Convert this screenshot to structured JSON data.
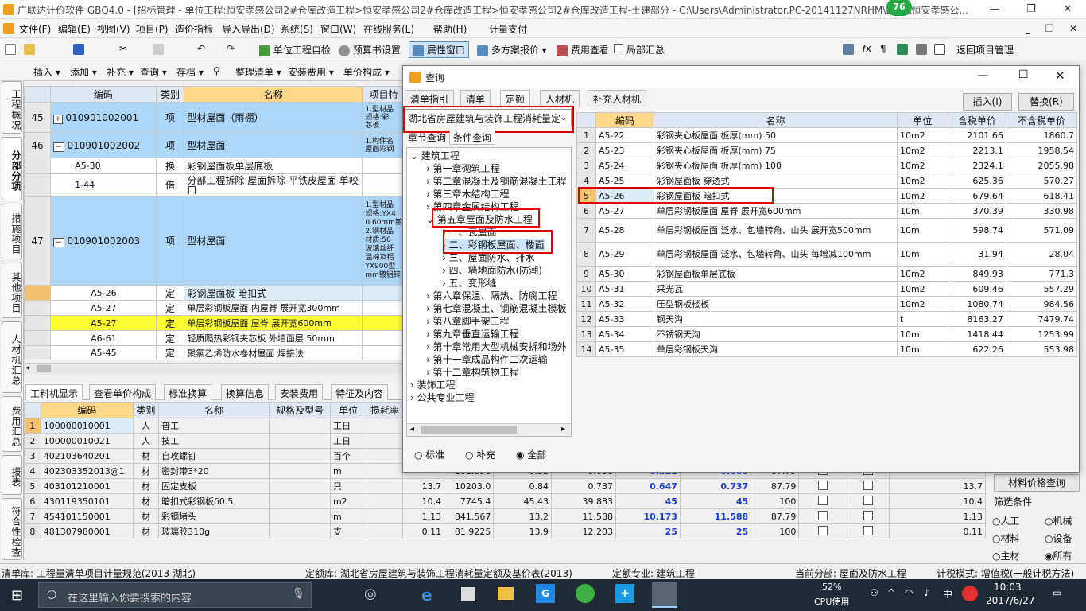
{
  "window": {
    "title": "广联达计价软件 GBQ4.0 - [招标管理 - 单位工程:恒安孝感公司2#仓库改造工程>恒安孝感公司2#仓库改造工程>恒安孝感公司2#仓库改造工程-土建部分 - C:\\Users\\Administrator.PC-20141127NRHM\\De...\\恒安孝感公...",
    "badge": "76",
    "minimize": "—",
    "restore": "❐",
    "close": "✕"
  },
  "menu": [
    "文件(F)",
    "编辑(E)",
    "视图(V)",
    "项目(P)",
    "造价指标",
    "导入导出(D)",
    "系统(S)",
    "窗口(W)",
    "在线服务(L)",
    "帮助(H)",
    "计量支付"
  ],
  "toolbar1": {
    "self_check": "单位工程自检",
    "budget_setting": "预算书设置",
    "property_window": "属性窗口",
    "multi_quote": "多方案报价",
    "fee_view": "费用查看",
    "partial_summary": "局部汇总",
    "return_project": "返回项目管理"
  },
  "toolbar2": {
    "insert": "插入",
    "add": "添加",
    "supplement": "补充",
    "query": "查询",
    "save": "存档",
    "organize": "整理清单",
    "install_fee": "安装费用",
    "price_compose": "单价构成"
  },
  "side_tabs": [
    "工程概况",
    "分部分项",
    "措施项目",
    "其他项目",
    "人材机汇总",
    "费用汇总",
    "报表",
    "符合性检查"
  ],
  "main_grid": {
    "headers": [
      "编码",
      "类别",
      "名称",
      "项目特"
    ],
    "rows": [
      {
        "no": "45",
        "code": "010901002001",
        "type": "项",
        "name": "型材屋面（雨棚）",
        "feature": "1.型材品\n规格:彩\n芯板"
      },
      {
        "no": "46",
        "code": "010901002002",
        "type": "项",
        "name": "型材屋面",
        "feature": "1.构件名\n屋面彩钢"
      },
      {
        "no": "",
        "code": "A5-30",
        "type": "换",
        "name": "彩钢屋面板单层底板",
        "feature": ""
      },
      {
        "no": "",
        "code": "1-44",
        "type": "借",
        "name": "分部工程拆除 屋面拆除 平铁皮屋面 单咬口",
        "feature": ""
      },
      {
        "no": "47",
        "code": "010901002003",
        "type": "项",
        "name": "型材屋面",
        "feature": "1.型材品\n规格:YX4\n0.60mm镀\n2.钢材品\n材质:50\n玻璃丝纤\n温棉及铝\nYX900型\nmm镀铝锌"
      },
      {
        "no": "",
        "code": "A5-26",
        "type": "定",
        "name": "彩钢屋面板 暗扣式",
        "feature": ""
      },
      {
        "no": "",
        "code": "A5-27",
        "type": "定",
        "name": "单层彩钢板屋面 内屋脊 展开宽300mm",
        "feature": ""
      },
      {
        "no": "",
        "code": "A5-27",
        "type": "定",
        "name": "单层彩钢板屋面 屋脊 展开宽600mm",
        "feature": ""
      },
      {
        "no": "",
        "code": "A6-61",
        "type": "定",
        "name": "轻质隔热彩钢夹芯板 外墙面层 50mm",
        "feature": ""
      },
      {
        "no": "",
        "code": "A5-45",
        "type": "定",
        "name": "聚氯乙烯防水卷材屋面 焊接法",
        "feature": ""
      }
    ]
  },
  "bottom_tabs": [
    "工料机显示",
    "查看单价构成",
    "标准换算",
    "换算信息",
    "安装费用",
    "特征及内容"
  ],
  "bottom_grid": {
    "headers": [
      "编码",
      "类别",
      "名称",
      "规格及型号",
      "单位",
      "损耗率"
    ],
    "rows": [
      {
        "no": "1",
        "code": "100000010001",
        "type": "人",
        "name": "普工",
        "spec": "",
        "unit": "工日",
        "loss": "",
        "a": "",
        "b": "",
        "c": "",
        "d": "",
        "e": "",
        "f": "",
        "g": "",
        "h": ""
      },
      {
        "no": "2",
        "code": "100000010021",
        "type": "人",
        "name": "技工",
        "spec": "",
        "unit": "工日",
        "loss": "",
        "a": "",
        "b": "",
        "c": "",
        "d": "",
        "e": "",
        "f": "",
        "g": "",
        "h": ""
      },
      {
        "no": "3",
        "code": "402103640201",
        "type": "材",
        "name": "自攻螺钉",
        "spec": "",
        "unit": "百个",
        "loss": "",
        "a": "",
        "b": "",
        "c": "",
        "d": "",
        "e": "",
        "f": "",
        "g": "",
        "h": ""
      },
      {
        "no": "4",
        "code": "402303352013@1",
        "type": "材",
        "name": "密封带3*20",
        "spec": "",
        "unit": "m",
        "loss": "",
        "a": "101.090",
        "b": "0.32",
        "c": "0.030",
        "d": "0.321",
        "e": "0.000",
        "f": "87.79",
        "g": "",
        "h": ""
      },
      {
        "no": "5",
        "code": "403101210001",
        "type": "材",
        "name": "固定支板",
        "spec": "",
        "unit": "只",
        "loss": "13.7",
        "a": "10203.0",
        "b": "0.84",
        "c": "0.737",
        "d": "0.647",
        "e": "0.737",
        "f": "87.79",
        "g": "13.7",
        "h": ""
      },
      {
        "no": "6",
        "code": "430119350101",
        "type": "材",
        "name": "暗扣式彩钢板δ0.5",
        "spec": "",
        "unit": "m2",
        "loss": "10.4",
        "a": "7745.4",
        "b": "45.43",
        "c": "39.883",
        "d": "45",
        "e": "45",
        "f": "100",
        "g": "10.4",
        "h": ""
      },
      {
        "no": "7",
        "code": "454101150001",
        "type": "材",
        "name": "彩钢堵头",
        "spec": "",
        "unit": "m",
        "loss": "1.13",
        "a": "841.567",
        "b": "13.2",
        "c": "11.588",
        "d": "10.173",
        "e": "11.588",
        "f": "87.79",
        "g": "1.13",
        "h": ""
      },
      {
        "no": "8",
        "code": "481307980001",
        "type": "材",
        "name": "玻璃胶310g",
        "spec": "",
        "unit": "支",
        "loss": "0.11",
        "a": "81.9225",
        "b": "13.9",
        "c": "12.203",
        "d": "25",
        "e": "25",
        "f": "100",
        "g": "0.11",
        "h": ""
      }
    ]
  },
  "right_panel": {
    "price_query": "材料价格查询",
    "filter_label": "筛选条件",
    "options": [
      "人工",
      "机械",
      "材料",
      "设备",
      "主材",
      "所有"
    ]
  },
  "dialog": {
    "title": "查询",
    "tabs": [
      "清单指引",
      "清单",
      "定额",
      "人材机",
      "补充人材机"
    ],
    "insert": "插入(I)",
    "replace": "替换(R)",
    "library": "湖北省房屋建筑与装饰工程消耗量定",
    "subtabs": [
      "章节查询",
      "条件查询"
    ],
    "tree": [
      "建筑工程",
      "第一章砌筑工程",
      "第二章混凝土及钢筋混凝土工程",
      "第三章木结构工程",
      "第四章金属结构工程",
      "第五章屋面及防水工程",
      "一、瓦屋面",
      "二、彩钢板屋面、楼面",
      "三、屋面防水、排水",
      "四、墙地面防水(防潮)",
      "五、变形缝",
      "第六章保温、隔热、防腐工程",
      "第七章混凝土、钢筋混凝土模板",
      "第八章脚手架工程",
      "第九章垂直运输工程",
      "第十章常用大型机械安拆和场外",
      "第十一章成品构件二次运输",
      "第十二章构筑物工程",
      "装饰工程",
      "公共专业工程"
    ],
    "radios": [
      "标准",
      "补充",
      "全部"
    ],
    "grid_headers": [
      "编码",
      "名称",
      "单位",
      "含税单价",
      "不含税单价"
    ],
    "grid_rows": [
      {
        "n": "1",
        "code": "A5-22",
        "name": "彩钢夹心板屋面 板厚(mm) 50",
        "unit": "10m2",
        "tax": "2101.66",
        "notax": "1860.7"
      },
      {
        "n": "2",
        "code": "A5-23",
        "name": "彩钢夹心板屋面 板厚(mm) 75",
        "unit": "10m2",
        "tax": "2213.1",
        "notax": "1958.54"
      },
      {
        "n": "3",
        "code": "A5-24",
        "name": "彩钢夹心板屋面 板厚(mm) 100",
        "unit": "10m2",
        "tax": "2324.1",
        "notax": "2055.98"
      },
      {
        "n": "4",
        "code": "A5-25",
        "name": "彩钢屋面板 穿透式",
        "unit": "10m2",
        "tax": "625.36",
        "notax": "570.27"
      },
      {
        "n": "5",
        "code": "A5-26",
        "name": "彩钢屋面板 暗扣式",
        "unit": "10m2",
        "tax": "679.64",
        "notax": "618.41"
      },
      {
        "n": "6",
        "code": "A5-27",
        "name": "单层彩钢板屋面 屋脊 展开宽600mm",
        "unit": "10m",
        "tax": "370.39",
        "notax": "330.98"
      },
      {
        "n": "7",
        "code": "A5-28",
        "name": "单层彩钢板屋面 泛水、包墙转角、山头 展开宽500mm",
        "unit": "10m",
        "tax": "598.74",
        "notax": "571.09"
      },
      {
        "n": "8",
        "code": "A5-29",
        "name": "单层彩钢板屋面 泛水、包墙转角、山头 每增减100mm",
        "unit": "10m",
        "tax": "31.94",
        "notax": "28.04"
      },
      {
        "n": "9",
        "code": "A5-30",
        "name": "彩钢屋面板单层底板",
        "unit": "10m2",
        "tax": "849.93",
        "notax": "771.3"
      },
      {
        "n": "10",
        "code": "A5-31",
        "name": "采光瓦",
        "unit": "10m2",
        "tax": "609.46",
        "notax": "557.29"
      },
      {
        "n": "11",
        "code": "A5-32",
        "name": "压型钢板楼板",
        "unit": "10m2",
        "tax": "1080.74",
        "notax": "984.56"
      },
      {
        "n": "12",
        "code": "A5-33",
        "name": "钢天沟",
        "unit": "t",
        "tax": "8163.27",
        "notax": "7479.74"
      },
      {
        "n": "13",
        "code": "A5-34",
        "name": "不锈钢天沟",
        "unit": "10m",
        "tax": "1418.44",
        "notax": "1253.99"
      },
      {
        "n": "14",
        "code": "A5-35",
        "name": "单层彩钢板天沟",
        "unit": "10m",
        "tax": "622.26",
        "notax": "553.98"
      }
    ]
  },
  "status": {
    "list_lib": "清单库:  工程量清单项目计量规范(2013-湖北)",
    "quota_lib": "定额库:  湖北省房屋建筑与装饰工程消耗量定额及基价表(2013)",
    "quota_spec": "定额专业:  建筑工程",
    "current_part": "当前分部:  屋面及防水工程",
    "tax_mode": "计税模式:  增值税(一般计税方法)"
  },
  "taskbar": {
    "search_placeholder": "在这里输入你要搜索的内容",
    "cpu": "52%",
    "cpu_label": "CPU使用",
    "ime": "中",
    "time": "10:03",
    "date": "2017/6/27"
  }
}
